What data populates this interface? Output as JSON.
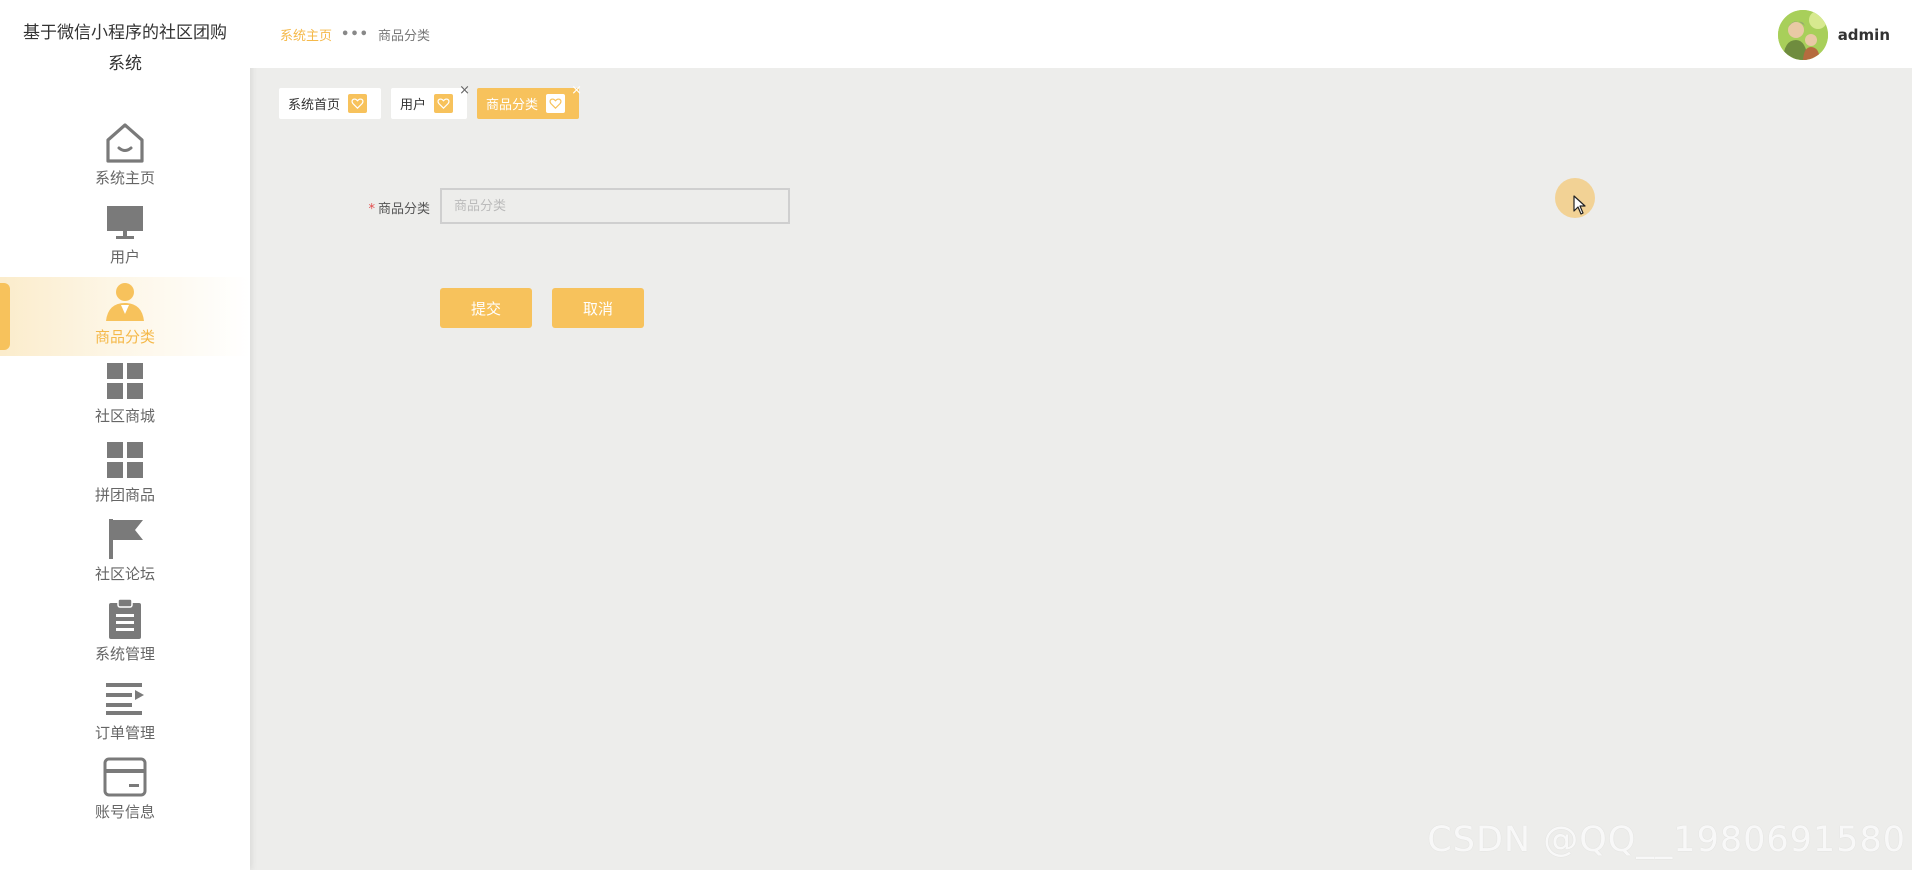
{
  "app": {
    "title": "基于微信小程序的社区团购系统"
  },
  "colors": {
    "accent": "#f7c25c",
    "accent_text": "#f5b94a",
    "icon_gray": "#7a7a7a"
  },
  "sidebar": {
    "items": [
      {
        "label": "系统主页",
        "icon": "home-icon",
        "active": false
      },
      {
        "label": "用户",
        "icon": "monitor-icon",
        "active": false
      },
      {
        "label": "商品分类",
        "icon": "person-icon",
        "active": true
      },
      {
        "label": "社区商城",
        "icon": "grid-icon",
        "active": false
      },
      {
        "label": "拼团商品",
        "icon": "grid-icon",
        "active": false
      },
      {
        "label": "社区论坛",
        "icon": "flag-icon",
        "active": false
      },
      {
        "label": "系统管理",
        "icon": "clipboard-icon",
        "active": false
      },
      {
        "label": "订单管理",
        "icon": "list-icon",
        "active": false
      },
      {
        "label": "账号信息",
        "icon": "card-icon",
        "active": false
      }
    ]
  },
  "header": {
    "breadcrumb": {
      "home": "系统主页",
      "separator": "•••",
      "current": "商品分类"
    },
    "user": {
      "name": "admin",
      "avatar": "avatar-image"
    }
  },
  "tags": [
    {
      "label": "系统首页",
      "closable": false,
      "active": false
    },
    {
      "label": "用户",
      "closable": true,
      "active": false
    },
    {
      "label": "商品分类",
      "closable": true,
      "active": true
    }
  ],
  "tag_close_glyph": "×",
  "form": {
    "field_label": "商品分类",
    "required_mark": "*",
    "field_value": "",
    "field_placeholder": "商品分类",
    "submit_label": "提交",
    "cancel_label": "取消"
  },
  "watermark": "CSDN @QQ__1980691580"
}
